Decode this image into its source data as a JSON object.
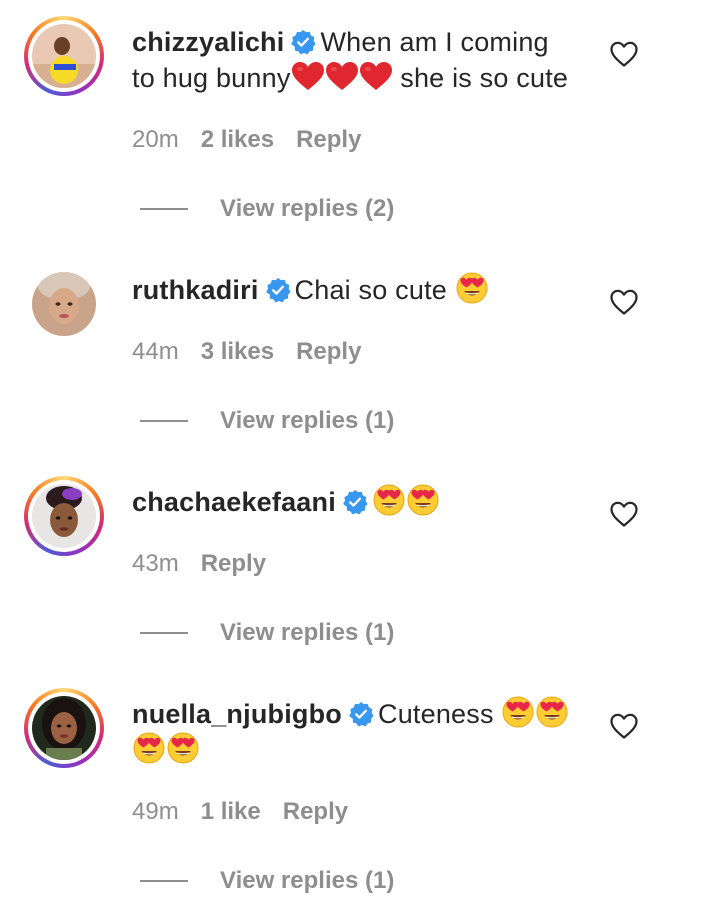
{
  "comments": [
    {
      "username": "chizzyalichi",
      "verified": true,
      "text_line1": "When am I coming",
      "text_line2_prefix": "to hug bunny",
      "text_line2_suffix": " she is so cute",
      "time": "20m",
      "likes": "2 likes",
      "reply_label": "Reply",
      "view_replies": "View replies (2)",
      "has_story": true
    },
    {
      "username": "ruthkadiri",
      "verified": true,
      "text": "Chai so cute ",
      "time": "44m",
      "likes": "3 likes",
      "reply_label": "Reply",
      "view_replies": "View replies (1)",
      "has_story": false
    },
    {
      "username": "chachaekefaani",
      "verified": true,
      "text": "",
      "time": "43m",
      "likes": "",
      "reply_label": "Reply",
      "view_replies": "View replies (1)",
      "has_story": true
    },
    {
      "username": "nuella_njubigbo",
      "verified": true,
      "text": "Cuteness ",
      "time": "49m",
      "likes": "1 like",
      "reply_label": "Reply",
      "view_replies": "View replies (1)",
      "has_story": true
    }
  ],
  "icons": {
    "verified": "verified-badge-icon",
    "like": "heart-outline-icon",
    "heart_emoji": "red-heart-emoji",
    "heart_eyes_emoji": "heart-eyes-emoji"
  },
  "colors": {
    "verified_blue": "#3897f0",
    "muted_text": "#8e8e8e",
    "primary_text": "#262626",
    "heart_red": "#e0262f"
  }
}
